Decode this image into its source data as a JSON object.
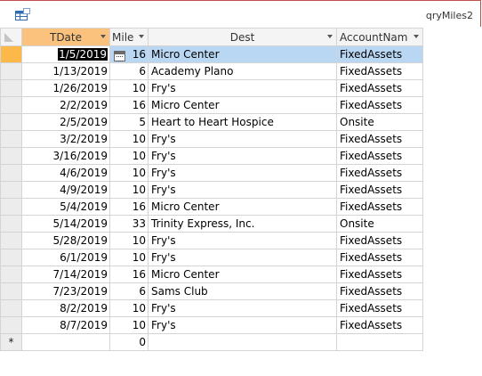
{
  "window": {
    "title": "qryMiles2"
  },
  "columns": [
    {
      "label": "TDate",
      "key": "tdate",
      "has_dropdown": true
    },
    {
      "label": "Mile",
      "key": "miles",
      "has_dropdown": true
    },
    {
      "label": "Dest",
      "key": "dest",
      "has_dropdown": true
    },
    {
      "label": "AccountNam",
      "key": "account",
      "has_dropdown": true
    }
  ],
  "current_row": 0,
  "rows": [
    {
      "tdate": "1/5/2019",
      "miles": "16",
      "dest": "Micro Center",
      "account": "FixedAssets"
    },
    {
      "tdate": "1/13/2019",
      "miles": "6",
      "dest": "Academy Plano",
      "account": "FixedAssets"
    },
    {
      "tdate": "1/26/2019",
      "miles": "10",
      "dest": "Fry's",
      "account": "FixedAssets"
    },
    {
      "tdate": "2/2/2019",
      "miles": "16",
      "dest": "Micro Center",
      "account": "FixedAssets"
    },
    {
      "tdate": "2/5/2019",
      "miles": "5",
      "dest": "Heart to Heart Hospice",
      "account": "Onsite"
    },
    {
      "tdate": "3/2/2019",
      "miles": "10",
      "dest": "Fry's",
      "account": "FixedAssets"
    },
    {
      "tdate": "3/16/2019",
      "miles": "10",
      "dest": "Fry's",
      "account": "FixedAssets"
    },
    {
      "tdate": "4/6/2019",
      "miles": "10",
      "dest": "Fry's",
      "account": "FixedAssets"
    },
    {
      "tdate": "4/9/2019",
      "miles": "10",
      "dest": "Fry's",
      "account": "FixedAssets"
    },
    {
      "tdate": "5/4/2019",
      "miles": "16",
      "dest": "Micro Center",
      "account": "FixedAssets"
    },
    {
      "tdate": "5/14/2019",
      "miles": "33",
      "dest": "Trinity Express, Inc.",
      "account": "Onsite"
    },
    {
      "tdate": "5/28/2019",
      "miles": "10",
      "dest": "Fry's",
      "account": "FixedAssets"
    },
    {
      "tdate": "6/1/2019",
      "miles": "10",
      "dest": "Fry's",
      "account": "FixedAssets"
    },
    {
      "tdate": "7/14/2019",
      "miles": "16",
      "dest": "Micro Center",
      "account": "FixedAssets"
    },
    {
      "tdate": "7/23/2019",
      "miles": "6",
      "dest": "Sams Club",
      "account": "FixedAssets"
    },
    {
      "tdate": "8/2/2019",
      "miles": "10",
      "dest": "Fry's",
      "account": "FixedAssets"
    },
    {
      "tdate": "8/7/2019",
      "miles": "10",
      "dest": "Fry's",
      "account": "FixedAssets"
    }
  ],
  "new_row": {
    "marker": "*",
    "miles": "0"
  }
}
